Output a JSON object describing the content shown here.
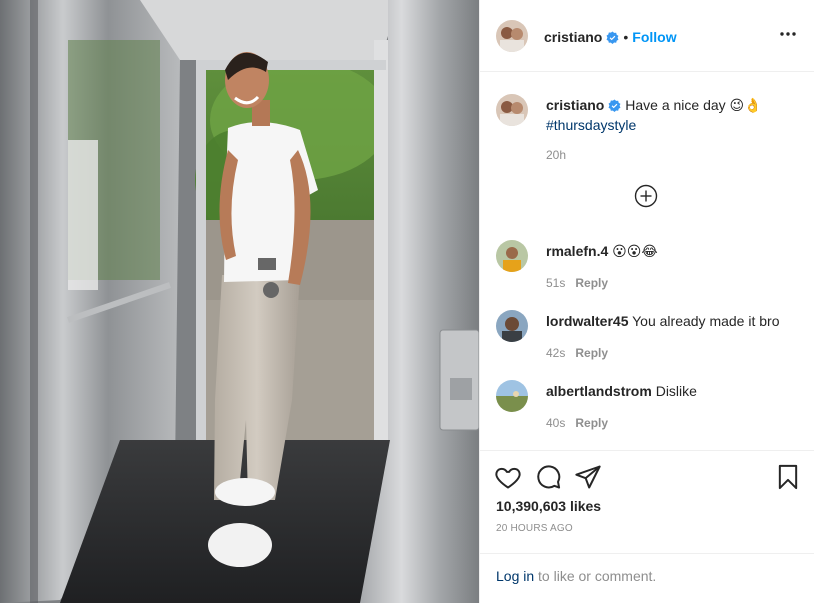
{
  "post": {
    "author": {
      "username": "cristiano",
      "avatar_icon": "profile-avatar",
      "verified_icon": "verified-badge-icon",
      "follow_label": "Follow",
      "more_icon": "more-options-icon"
    },
    "caption": {
      "username": "cristiano",
      "text": "Have a nice day 😉👌",
      "hashtag": "#thursdaystyle",
      "time": "20h"
    },
    "load_more_icon": "load-more-comments-icon",
    "comments": [
      {
        "username": "rmalefn.4",
        "text": "😮😮😂",
        "time": "51s",
        "reply_label": "Reply"
      },
      {
        "username": "lordwalter45",
        "text": "You already made it bro",
        "time": "42s",
        "reply_label": "Reply"
      },
      {
        "username": "albertlandstrom",
        "text": "Dislike",
        "time": "40s",
        "reply_label": "Reply"
      }
    ],
    "actions": {
      "like_icon": "heart-icon",
      "comment_icon": "comment-icon",
      "share_icon": "share-icon",
      "save_icon": "bookmark-icon"
    },
    "likes": "10,390,603 likes",
    "posted_ago": "20 HOURS AGO",
    "login": {
      "link": "Log in",
      "rest": "to like or comment."
    }
  },
  "colors": {
    "accent": "#0095f6",
    "verified": "#3897f0",
    "text": "#262626",
    "muted": "#8e8e8e",
    "link": "#00376b"
  }
}
